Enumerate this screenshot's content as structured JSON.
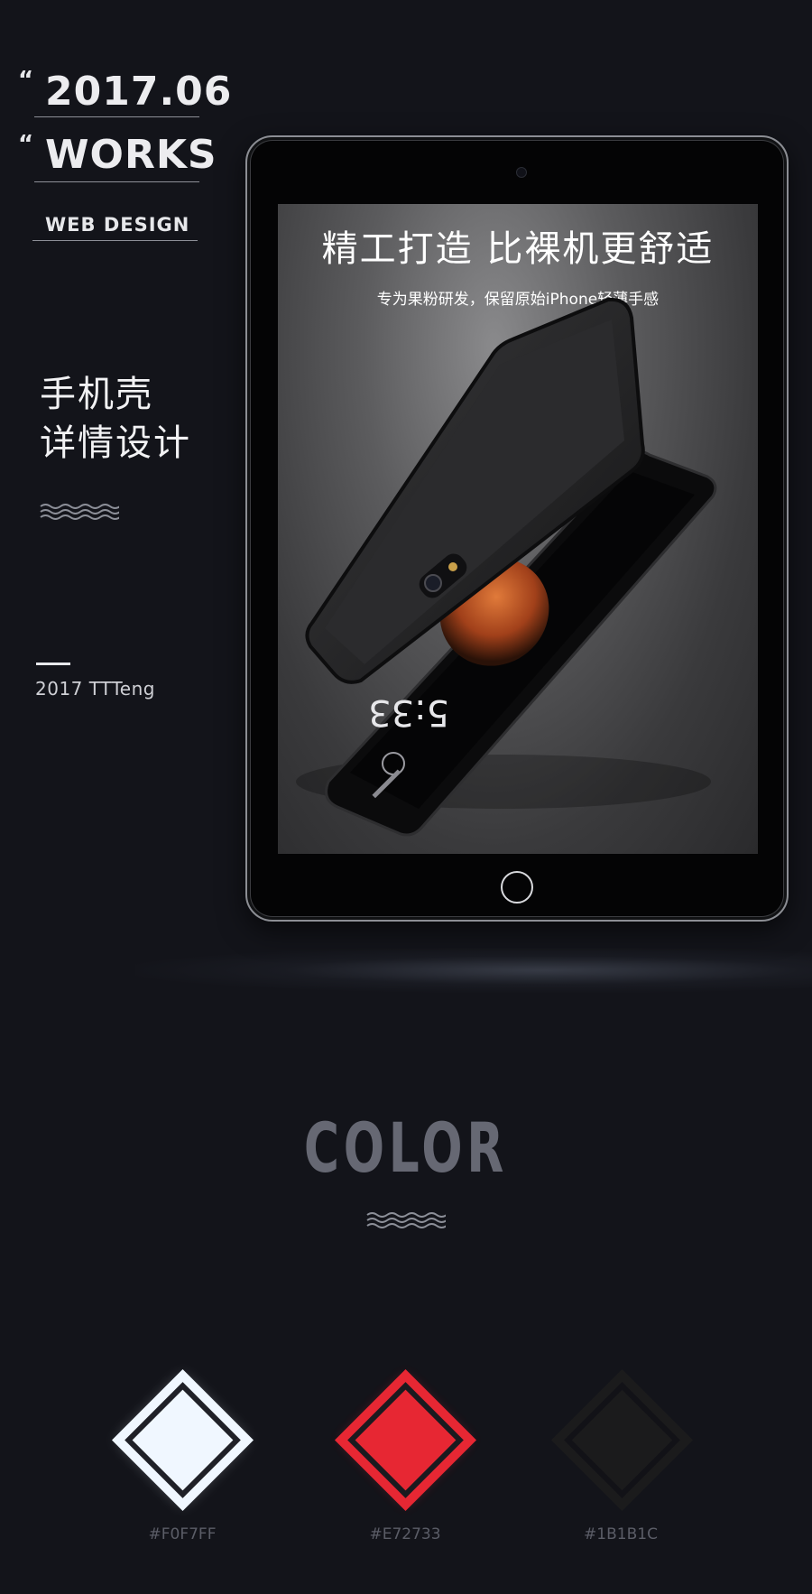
{
  "header": {
    "date": "2017.06",
    "works": "WORKS",
    "category": "WEB DESIGN",
    "quote_mark": "“"
  },
  "project": {
    "title_line1": "手机壳",
    "title_line2": "详情设计",
    "credit": "2017  TTTeng"
  },
  "tablet_screen": {
    "headline": "精工打造 比裸机更舒适",
    "subline": "专为果粉研发，保留原始iPhone轻薄手感",
    "lockscreen_time": "5:33"
  },
  "color_section": {
    "title": "COLOR",
    "swatches": [
      {
        "hex": "#F0F7FF",
        "color": "#F0F7FF"
      },
      {
        "hex": "#E72733",
        "color": "#E72733"
      },
      {
        "hex": "#1B1B1C",
        "color": "#1B1B1C"
      }
    ]
  },
  "colors": {
    "background": "#13141a",
    "wave": "#8c8f98",
    "title_gray": "#666873"
  }
}
